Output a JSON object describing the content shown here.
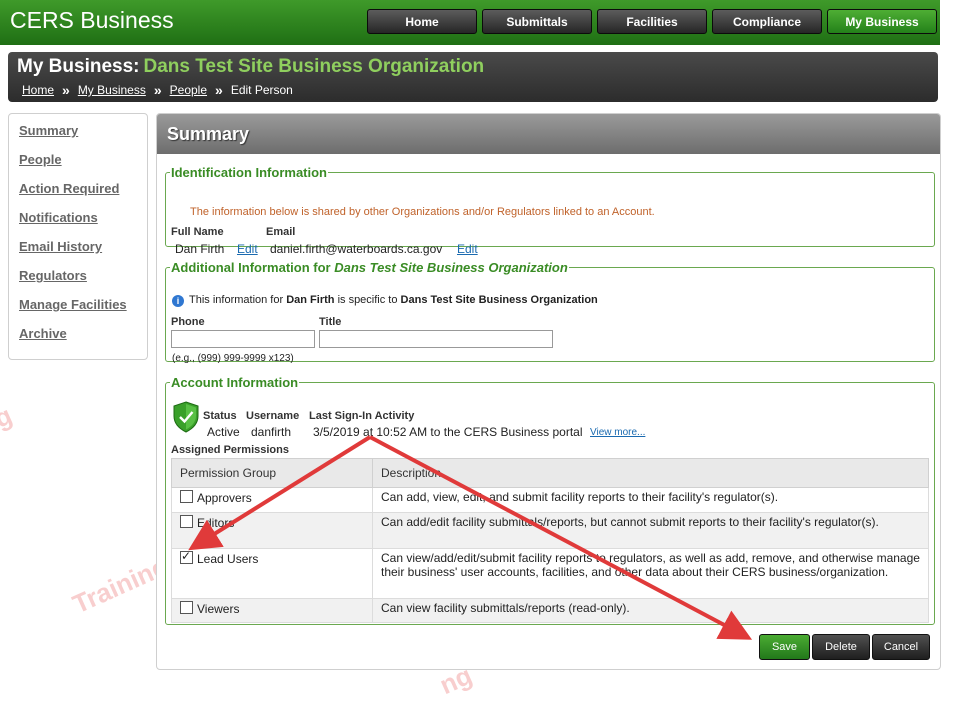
{
  "app": {
    "brand": "CERS Business"
  },
  "nav": [
    "Home",
    "Submittals",
    "Facilities",
    "Compliance",
    "My Business"
  ],
  "header": {
    "prefix": "My Business:",
    "org": "Dans Test Site Business Organization",
    "breadcrumbs": [
      "Home",
      "My Business",
      "People",
      "Edit Person"
    ],
    "separator": "»"
  },
  "sidebar": [
    "Summary",
    "People",
    "Action Required",
    "Notifications",
    "Email History",
    "Regulators",
    "Manage Facilities",
    "Archive"
  ],
  "main": {
    "title": "Summary",
    "identification": {
      "legend": "Identification Information",
      "notice": "The information below is shared by other Organizations and/or Regulators linked to an Account.",
      "full_name_label": "Full Name",
      "full_name": "Dan Firth",
      "email_label": "Email",
      "email": "daniel.firth@waterboards.ca.gov",
      "edit_label": "Edit"
    },
    "additional": {
      "legend_prefix": "Additional Information for",
      "legend_org": "Dans Test Site Business Organization",
      "info_1": "This information for",
      "info_name": "Dan Firth",
      "info_2": "is specific to",
      "info_org": "Dans Test Site Business Organization",
      "phone_label": "Phone",
      "phone_value": "",
      "phone_hint": "(e.g., (999) 999-9999 x123)",
      "title_label": "Title",
      "title_value": ""
    },
    "account": {
      "legend": "Account Information",
      "status_label": "Status",
      "status": "Active",
      "username_label": "Username",
      "username": "danfirth",
      "last_signin_label": "Last Sign-In Activity",
      "last_signin": "3/5/2019 at 10:52 AM to the CERS Business portal",
      "view_more": "View more...",
      "assigned_label": "Assigned Permissions",
      "table_headers": [
        "Permission Group",
        "Description"
      ],
      "permissions": [
        {
          "group": "Approvers",
          "checked": false,
          "description": "Can add, view, edit, and submit facility reports to their facility's regulator(s)."
        },
        {
          "group": "Editors",
          "checked": false,
          "description": "Can add/edit facility submittals/reports, but cannot submit reports to their facility's regulator(s)."
        },
        {
          "group": "Lead Users",
          "checked": true,
          "description": "Can view/add/edit/submit facility reports to regulators, as well as add, remove, and otherwise manage their business' user accounts, facilities, and other data about their CERS business/organization."
        },
        {
          "group": "Viewers",
          "checked": false,
          "description": "Can view facility submittals/reports (read-only)."
        }
      ]
    },
    "buttons": {
      "save": "Save",
      "delete": "Delete",
      "cancel": "Cancel"
    }
  },
  "watermark": "Training",
  "colors": {
    "brand_green": "#2e8b1f",
    "legend_green": "#3a8c25",
    "notice_orange": "#c0622a",
    "annotation_red": "#e03a3a",
    "header_dark": "#333333"
  }
}
